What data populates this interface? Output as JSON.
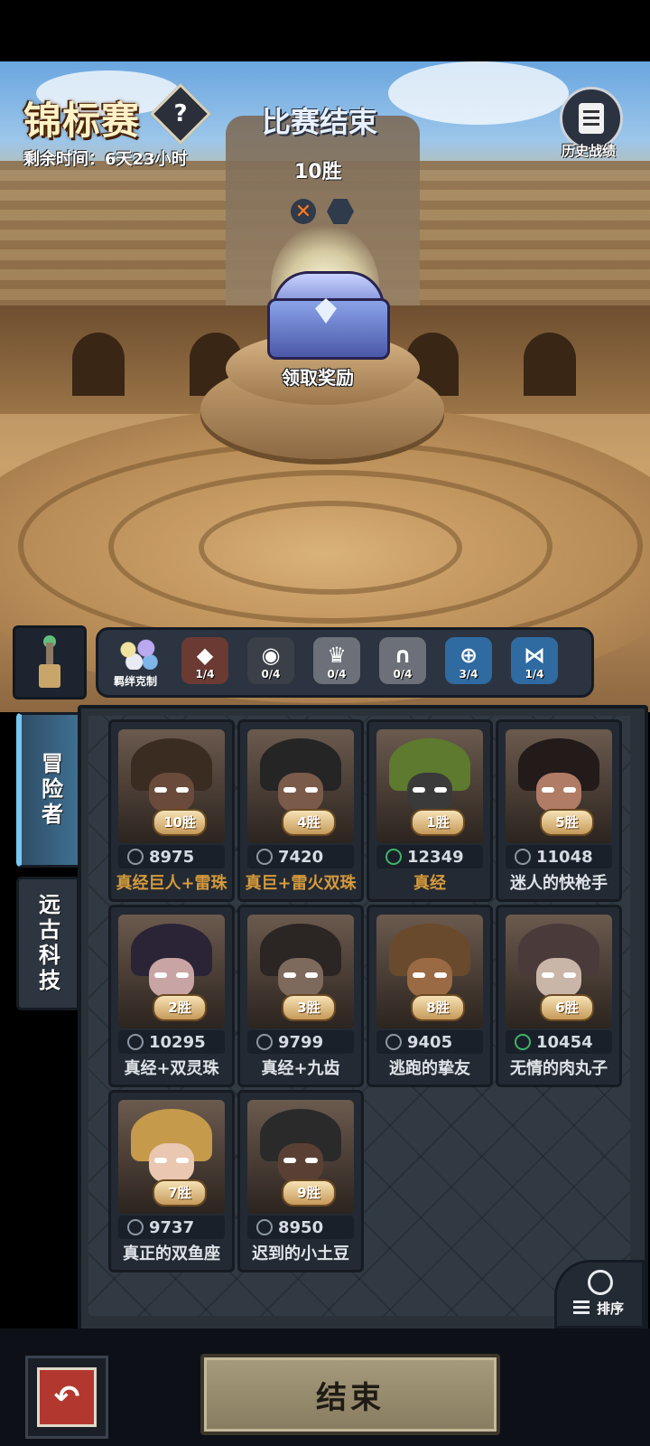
{
  "header": {
    "title": "锦标赛",
    "help_symbol": "?",
    "remaining_time": "剩余时间：6天23小时",
    "match_status": "比赛结束",
    "wins": "10胜",
    "result_icons": [
      "loss-x-icon",
      "empty-hexagon-icon"
    ],
    "history_label": "历史战绩"
  },
  "reward": {
    "claim_label": "领取奖励"
  },
  "synergy": {
    "first_label": "羁绊克制",
    "slots": [
      {
        "icon": "diamond-icon",
        "count": "1/4",
        "color": "#6b3a33"
      },
      {
        "icon": "eye-icon",
        "count": "0/4",
        "color": "#3a3f48"
      },
      {
        "icon": "crown-icon",
        "count": "0/4",
        "color": "#6c7078"
      },
      {
        "icon": "arch-icon",
        "count": "0/4",
        "color": "#6c7078"
      },
      {
        "icon": "crosshair-icon",
        "count": "3/4",
        "color": "#2f6aa0"
      },
      {
        "icon": "figure-icon",
        "count": "1/4",
        "color": "#2f6aa0"
      }
    ]
  },
  "tabs": {
    "adventurer": "冒险者",
    "ancient_tech": "远古科技"
  },
  "cards": [
    {
      "wins": "10胜",
      "score": "8975",
      "name": "真经巨人+雷珠",
      "gold": true,
      "icon_green": false,
      "hat": "#3b2c22",
      "face": "#6a4a3a"
    },
    {
      "wins": "4胜",
      "score": "7420",
      "name": "真巨+雷火双珠",
      "gold": true,
      "icon_green": false,
      "hat": "#252525",
      "face": "#7a5a48"
    },
    {
      "wins": "1胜",
      "score": "12349",
      "name": "真经",
      "gold": true,
      "icon_green": true,
      "hat": "#5d7a2e",
      "face": "#3a3a3a"
    },
    {
      "wins": "5胜",
      "score": "11048",
      "name": "迷人的快枪手",
      "gold": false,
      "icon_green": false,
      "hat": "#231a1a",
      "face": "#b07c66"
    },
    {
      "wins": "2胜",
      "score": "10295",
      "name": "真经+双灵珠",
      "gold": false,
      "icon_green": false,
      "hat": "#2a2436",
      "face": "#c9a4a4"
    },
    {
      "wins": "3胜",
      "score": "9799",
      "name": "真经+九齿",
      "gold": false,
      "icon_green": false,
      "hat": "#2b2523",
      "face": "#7d6a5c"
    },
    {
      "wins": "8胜",
      "score": "9405",
      "name": "逃跑的挚友",
      "gold": false,
      "icon_green": false,
      "hat": "#6a4a2c",
      "face": "#9a6a44"
    },
    {
      "wins": "6胜",
      "score": "10454",
      "name": "无情的肉丸子",
      "gold": false,
      "icon_green": true,
      "hat": "#4a3a3a",
      "face": "#c9b6a8"
    },
    {
      "wins": "7胜",
      "score": "9737",
      "name": "真正的双鱼座",
      "gold": false,
      "icon_green": false,
      "hat": "#c59a4a",
      "face": "#e9c7b0"
    },
    {
      "wins": "9胜",
      "score": "8950",
      "name": "迟到的小土豆",
      "gold": false,
      "icon_green": false,
      "hat": "#2a2a2a",
      "face": "#5a4034"
    }
  ],
  "sort_label": "排序",
  "footer": {
    "back_symbol": "↶",
    "end_label": "结束"
  }
}
